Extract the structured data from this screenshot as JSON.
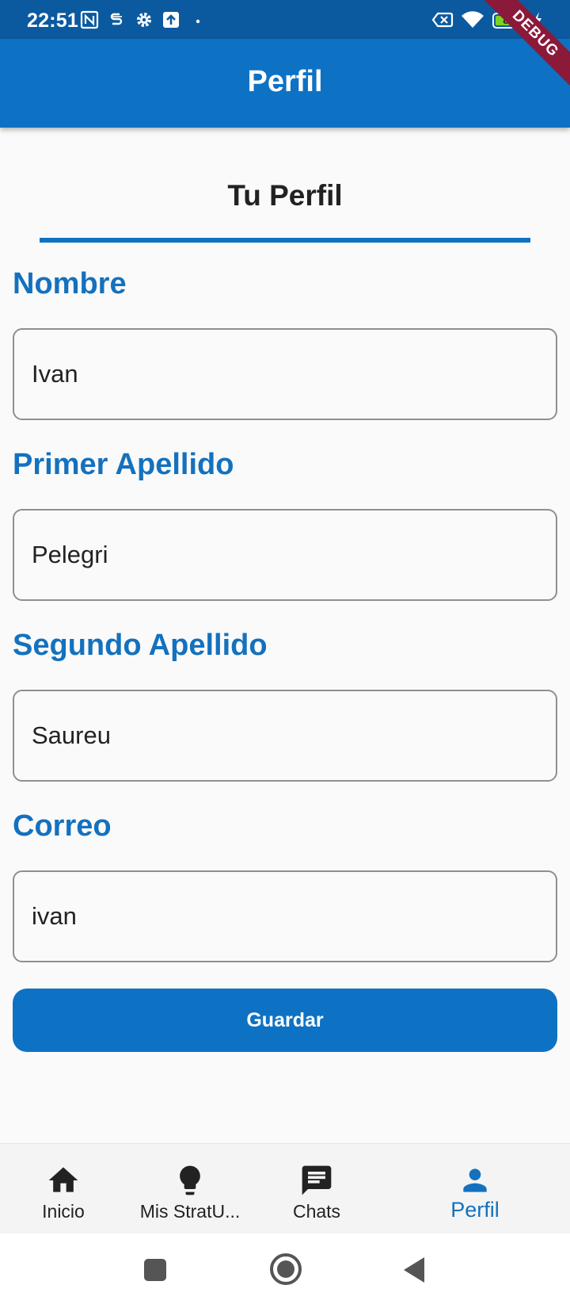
{
  "status_bar": {
    "time": "22:51",
    "battery_percent": "89",
    "battery_level": 0.89,
    "icons": [
      "nfc-icon",
      "s-icon",
      "gear-icon",
      "upload-icon",
      "dot-icon",
      "no-sim-icon",
      "wifi-icon",
      "battery-icon",
      "charging-icon"
    ]
  },
  "debug_banner": "DEBUG",
  "app_bar": {
    "title": "Perfil"
  },
  "section": {
    "title": "Tu Perfil"
  },
  "form": {
    "nombre": {
      "label": "Nombre",
      "value": "Ivan"
    },
    "primer_apellido": {
      "label": "Primer Apellido",
      "value": "Pelegri"
    },
    "segundo_apellido": {
      "label": "Segundo Apellido",
      "value": "Saureu"
    },
    "correo": {
      "label": "Correo",
      "value": "ivan"
    },
    "save_label": "Guardar"
  },
  "bottom_nav": {
    "items": [
      {
        "label": "Inicio",
        "icon": "home-icon"
      },
      {
        "label": "Mis StratU...",
        "icon": "lightbulb-icon"
      },
      {
        "label": "Chats",
        "icon": "chat-icon"
      },
      {
        "label": "Perfil",
        "icon": "person-icon",
        "active": true
      }
    ]
  },
  "system_nav": {
    "icons": [
      "recents-icon",
      "home-circle-icon",
      "back-icon"
    ]
  },
  "colors": {
    "primary": "#0e72c4",
    "status_bar": "#0b5aa0",
    "label": "#1471be",
    "debug": "#8b1a3a"
  }
}
